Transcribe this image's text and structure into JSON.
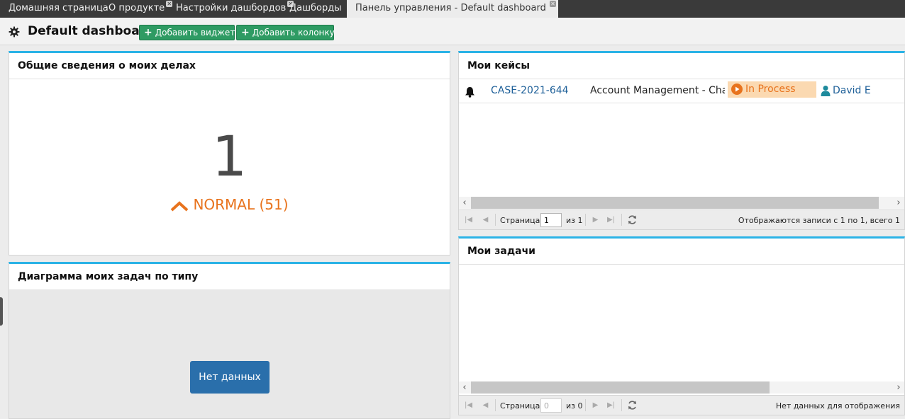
{
  "tabs": [
    {
      "label": "Домашняя страница",
      "closable": false,
      "active": false
    },
    {
      "label": "О продукте",
      "closable": true,
      "active": false
    },
    {
      "label": "Настройки дашбордов",
      "closable": true,
      "active": false
    },
    {
      "label": "Дашборды",
      "closable": false,
      "active": false
    },
    {
      "label": "Панель управления - Default dashboard",
      "closable": true,
      "active": true
    }
  ],
  "toolbar": {
    "title": "Default dashboard",
    "add_widget_label": "Добавить виджет",
    "add_column_label": "Добавить колонку"
  },
  "summary_widget": {
    "title": "Общие сведения о моих делах",
    "count": "1",
    "trend_label": "NORMAL (51)",
    "trend_color": "#e8731d"
  },
  "tasks_chart_widget": {
    "title": "Диаграмма моих задач по типу",
    "no_data_label": "Нет данных"
  },
  "my_cases": {
    "title": "Мои кейсы",
    "rows": [
      {
        "icon": "bell-icon",
        "case_number": "CASE-2021-644",
        "case_title": "Account Management - Cha...",
        "status": "In Process",
        "owner": "David E"
      }
    ],
    "pager": {
      "page_label": "Страница",
      "page_value": "1",
      "of_label": "из 1",
      "info": "Отображаются записи с 1 по 1, всего 1"
    }
  },
  "my_tasks": {
    "title": "Мои задачи",
    "pager": {
      "page_label": "Страница",
      "page_value": "0",
      "of_label": "из 0",
      "info": "Нет данных для отображения"
    }
  },
  "colors": {
    "accent": "#2bb3e6",
    "green_button": "#2e9b63",
    "status_bg": "#fbd9b1",
    "link": "#1d5f98",
    "no_data_button": "#2a6fab"
  }
}
